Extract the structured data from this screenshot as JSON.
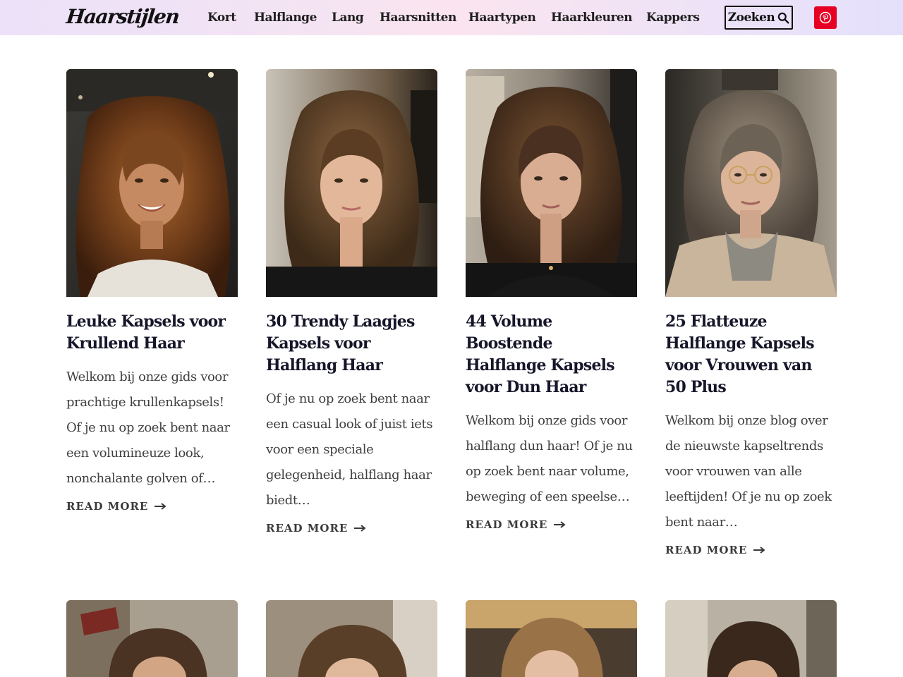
{
  "site": {
    "logo": "Haarstijlen"
  },
  "nav": {
    "items": [
      {
        "label": "Kort"
      },
      {
        "label": "Halflange"
      },
      {
        "label": "Lang"
      },
      {
        "label": "Haarsnitten"
      },
      {
        "label": "Haartypen"
      },
      {
        "label": "Haarkleuren"
      },
      {
        "label": "Kappers"
      }
    ],
    "search_label": "Zoeken",
    "search_icon": "search-icon",
    "social_icon": "pinterest-icon"
  },
  "colors": {
    "pinterest": "#e60023",
    "title": "#16162a",
    "excerpt": "#3f3f3f"
  },
  "posts": [
    {
      "title": "Leuke Kapsels voor Krullend Haar",
      "excerpt": "Welkom bij onze gids voor prachtige krullenkapsels! Of je nu op zoek bent naar een volumineuze look, nonchalante golven of…",
      "read_more": "Read More"
    },
    {
      "title": "30 Trendy Laagjes Kapsels voor Halflang Haar",
      "excerpt": "Of je nu op zoek bent naar een casual look of juist iets voor een speciale gelegenheid, halflang haar biedt…",
      "read_more": "Read More"
    },
    {
      "title": "44 Volume Boostende Halflange Kapsels voor Dun Haar",
      "excerpt": "Welkom bij onze gids voor halflang dun haar! Of je nu op zoek bent naar volume, beweging of een speelse…",
      "read_more": "Read More"
    },
    {
      "title": "25 Flatteuze Halflange Kapsels voor Vrouwen van 50 Plus",
      "excerpt": "Welkom bij onze blog over de nieuwste kapseltrends voor vrouwen van alle leeftijden! Of je nu op zoek bent naar…",
      "read_more": "Read More"
    }
  ]
}
